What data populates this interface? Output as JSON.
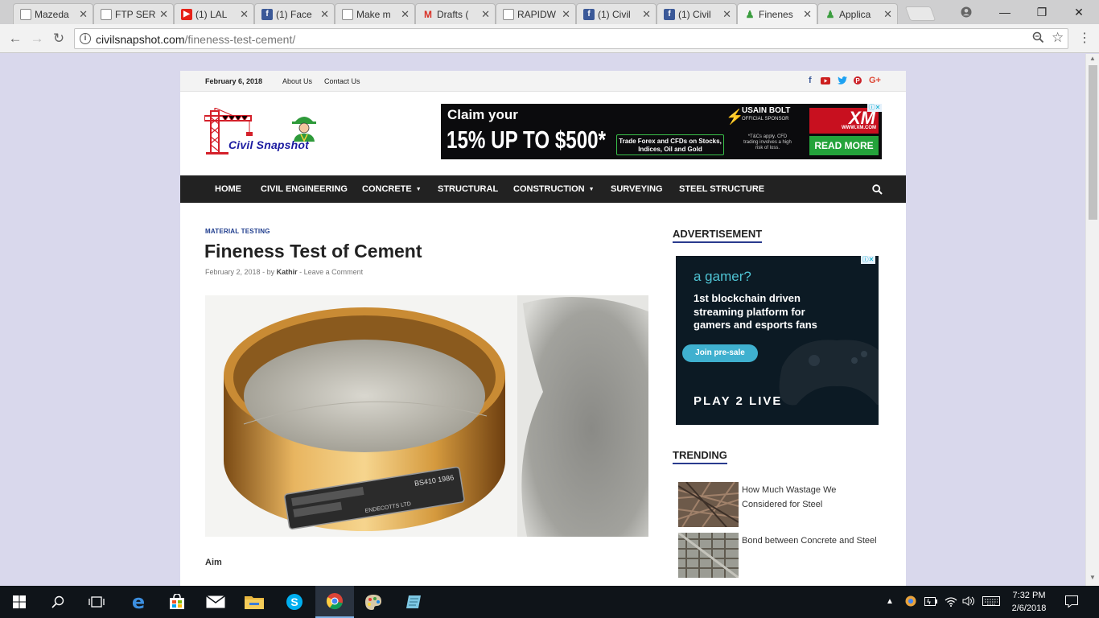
{
  "browser": {
    "tabs": [
      {
        "title": "Mazeda",
        "icon": "doc"
      },
      {
        "title": "FTP SER",
        "icon": "doc"
      },
      {
        "title": "(1) LAL",
        "icon": "youtube"
      },
      {
        "title": "(1) Face",
        "icon": "facebook"
      },
      {
        "title": "Make m",
        "icon": "doc"
      },
      {
        "title": "Drafts (",
        "icon": "gmail"
      },
      {
        "title": "RAPIDW",
        "icon": "doc"
      },
      {
        "title": "(1) Civil",
        "icon": "facebook"
      },
      {
        "title": "(1) Civil",
        "icon": "facebook"
      },
      {
        "title": "Finenes",
        "icon": "civil",
        "active": true
      },
      {
        "title": "Applica",
        "icon": "civil"
      }
    ],
    "url_host": "civilsnapshot.com",
    "url_path": "/fineness-test-cement/"
  },
  "topbar": {
    "date": "February 6, 2018",
    "links": [
      "About Us",
      "Contact Us"
    ],
    "social_icons": [
      "facebook-icon",
      "youtube-icon",
      "twitter-icon",
      "pinterest-icon",
      "google-plus-icon"
    ]
  },
  "logo": {
    "text": "Civil Snapshot"
  },
  "header_ad": {
    "claim": "Claim your",
    "headline": "15% UP TO $500*",
    "trade": "Trade Forex and CFDs on Stocks, Indices, Oil and Gold",
    "sponsor_name": "USAIN BOLT",
    "sponsor_role": "OFFICIAL SPONSOR",
    "tnc": "*T&Cs apply. CFD trading involves a high risk of loss.",
    "brand": "XM",
    "brand_url": "WWW.XM.COM",
    "cta": "READ MORE"
  },
  "nav": {
    "items": [
      {
        "label": "HOME",
        "dropdown": false
      },
      {
        "label": "CIVIL ENGINEERING",
        "dropdown": false
      },
      {
        "label": "CONCRETE",
        "dropdown": true
      },
      {
        "label": "STRUCTURAL",
        "dropdown": false
      },
      {
        "label": "CONSTRUCTION",
        "dropdown": true
      },
      {
        "label": "SURVEYING",
        "dropdown": false
      },
      {
        "label": "STEEL STRUCTURE",
        "dropdown": false
      }
    ]
  },
  "article": {
    "category": "MATERIAL TESTING",
    "title": "Fineness Test of Cement",
    "date": "February 2, 2018",
    "by": "by",
    "author": "Kathir",
    "comment_link": "Leave a Comment",
    "aim": "Aim",
    "sieve_label": "BS410 1986",
    "sieve_maker": "ENDECOTTS LTD"
  },
  "sidebar": {
    "advertisement_heading": "ADVERTISEMENT",
    "side_ad": {
      "question": "a gamer?",
      "copy_lines": [
        "1st blockchain driven",
        "streaming platform for",
        "gamers and esports fans"
      ],
      "cta": "Join pre-sale",
      "brand": "PLAY 2 LIVE"
    },
    "trending_heading": "TRENDING",
    "trending": [
      {
        "title": "How Much Wastage We Considered for Steel"
      },
      {
        "title": "Bond between Concrete and Steel"
      }
    ]
  },
  "taskbar": {
    "time": "7:32 PM",
    "date": "2/6/2018"
  }
}
